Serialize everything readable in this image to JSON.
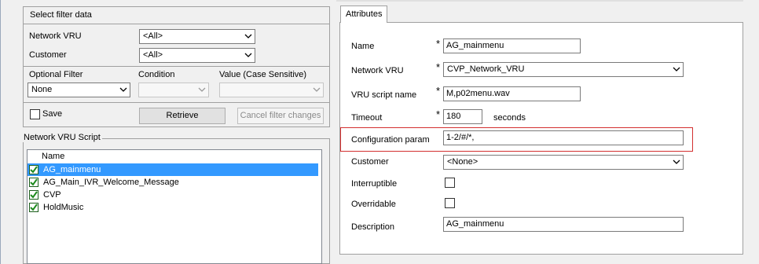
{
  "filter": {
    "title": "Select filter data",
    "network_vru_label": "Network VRU",
    "network_vru_value": "<All>",
    "customer_label": "Customer",
    "customer_value": "<All>",
    "optional_filter_label": "Optional Filter",
    "optional_filter_value": "None",
    "condition_label": "Condition",
    "condition_value": "",
    "value_label": "Value (Case Sensitive)",
    "value_value": "",
    "save_label": "Save",
    "retrieve_label": "Retrieve",
    "cancel_label": "Cancel filter changes"
  },
  "script_list": {
    "title": "Network VRU Script",
    "column_header": "Name",
    "items": [
      {
        "label": "AG_mainmenu",
        "selected": true
      },
      {
        "label": "AG_Main_IVR_Welcome_Message",
        "selected": false
      },
      {
        "label": "CVP",
        "selected": false
      },
      {
        "label": "HoldMusic",
        "selected": false
      }
    ]
  },
  "attributes": {
    "tab_label": "Attributes",
    "required_mark": "*",
    "name_label": "Name",
    "name_value": "AG_mainmenu",
    "network_vru_label": "Network VRU",
    "network_vru_value": "CVP_Network_VRU",
    "vru_script_name_label": "VRU script name",
    "vru_script_name_value": "M,p02menu.wav",
    "timeout_label": "Timeout",
    "timeout_value": "180",
    "timeout_unit": "seconds",
    "config_param_label": "Configuration param",
    "config_param_value": "1-2/#/*,",
    "customer_label": "Customer",
    "customer_value": "<None>",
    "interruptible_label": "Interruptible",
    "interruptible_checked": false,
    "overridable_label": "Overridable",
    "overridable_checked": false,
    "description_label": "Description",
    "description_value": "AG_mainmenu"
  },
  "colors": {
    "selection": "#3399ff",
    "highlight_border": "#d32f2f",
    "check_green": "#1d8a1d"
  }
}
